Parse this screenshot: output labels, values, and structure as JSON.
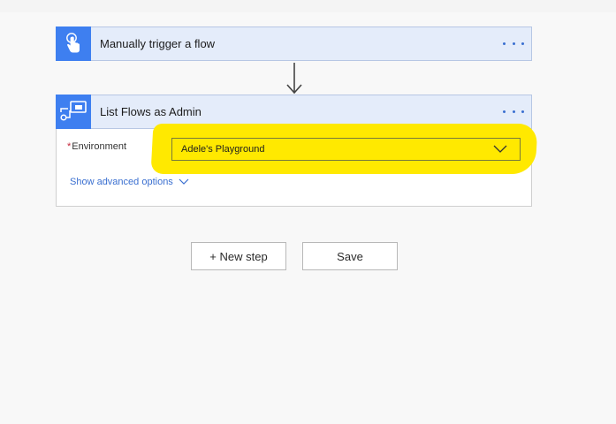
{
  "trigger": {
    "title": "Manually trigger a flow",
    "icon": "touch-hand-icon",
    "accent": "#3e7ff0"
  },
  "action": {
    "title": "List Flows as Admin",
    "icon": "flow-admin-icon",
    "accent": "#3e7ff0",
    "environment": {
      "label": "Environment",
      "required_marker": "*",
      "value": "Adele's Playground"
    },
    "advanced_options_label": "Show advanced options"
  },
  "buttons": {
    "new_step": "+ New step",
    "save": "Save"
  },
  "colors": {
    "header_bg": "#e4ecfa",
    "link": "#3a6fd0",
    "highlight": "#ffe900"
  }
}
